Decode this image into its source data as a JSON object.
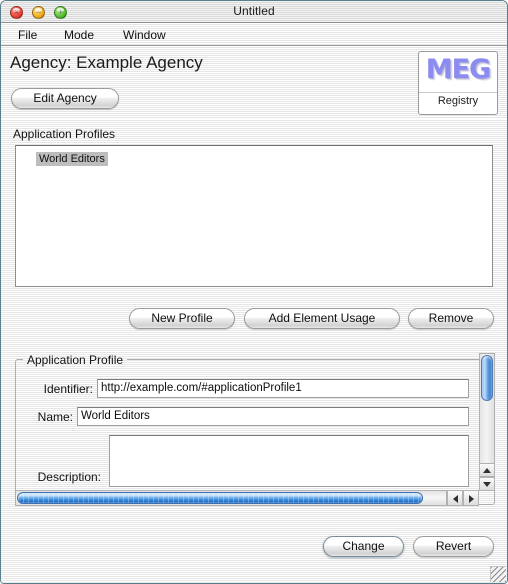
{
  "window": {
    "title": "Untitled",
    "controls": {
      "close_label": "×",
      "minimize_label": "−",
      "zoom_label": "+"
    }
  },
  "menubar": {
    "items": [
      {
        "label": "File"
      },
      {
        "label": "Mode"
      },
      {
        "label": "Window"
      }
    ]
  },
  "header": {
    "page_title": "Agency: Example Agency",
    "edit_agency_label": "Edit Agency",
    "logo": {
      "mark": "MEG",
      "subtitle": "Registry"
    }
  },
  "profiles": {
    "group_label": "Application Profiles",
    "items": [
      {
        "label": "World Editors",
        "selected": true
      }
    ],
    "actions": [
      {
        "label": "New Profile"
      },
      {
        "label": "Add Element Usage"
      },
      {
        "label": "Remove"
      }
    ]
  },
  "form": {
    "group_label": "Application Profile",
    "fields": {
      "identifier_label": "Identifier:",
      "identifier_value": "http://example.com/#applicationProfile1",
      "name_label": "Name:",
      "name_value": "World Editors",
      "description_label": "Description:",
      "description_value": ""
    }
  },
  "footer": {
    "change_label": "Change",
    "revert_label": "Revert"
  },
  "icons": {
    "scroll_up": "scroll-up-arrow-icon",
    "scroll_down": "scroll-down-arrow-icon",
    "scroll_left": "scroll-left-arrow-icon",
    "scroll_right": "scroll-right-arrow-icon",
    "resize_grip": "resize-grip-icon"
  },
  "colors": {
    "window_border": "#5a7f8c",
    "aqua_blue": "#2f6fc0",
    "logo_purple": "#8b8bf0",
    "selection_gray": "#bdbdbd"
  }
}
